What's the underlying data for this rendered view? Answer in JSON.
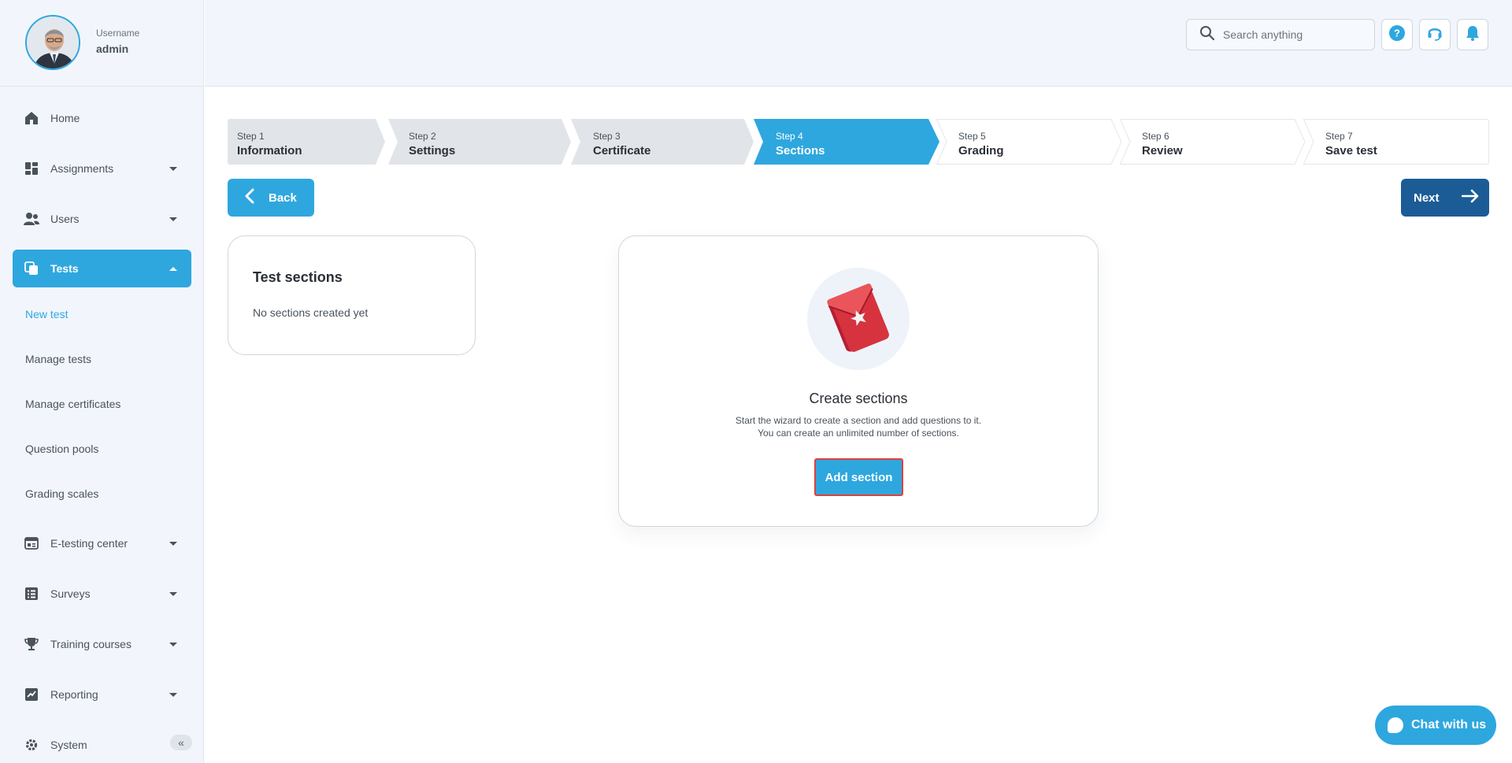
{
  "profile": {
    "label": "Username",
    "name": "admin"
  },
  "sidebar": {
    "items": [
      {
        "label": "Home",
        "icon": "home-icon"
      },
      {
        "label": "Assignments",
        "icon": "assignments-icon"
      },
      {
        "label": "Users",
        "icon": "users-icon"
      },
      {
        "label": "Tests",
        "icon": "tests-icon"
      },
      {
        "label": "E-testing center",
        "icon": "e-testing-icon"
      },
      {
        "label": "Surveys",
        "icon": "surveys-icon"
      },
      {
        "label": "Training courses",
        "icon": "trophy-icon"
      },
      {
        "label": "Reporting",
        "icon": "reporting-icon"
      },
      {
        "label": "System",
        "icon": "gear-icon"
      }
    ],
    "tests_subitems": [
      {
        "label": "New test"
      },
      {
        "label": "Manage tests"
      },
      {
        "label": "Manage certificates"
      },
      {
        "label": "Question pools"
      },
      {
        "label": "Grading scales"
      }
    ],
    "collapse_glyph": "«"
  },
  "header": {
    "search_placeholder": "Search anything"
  },
  "stepper": [
    {
      "num": "Step 1",
      "name": "Information",
      "state": "done"
    },
    {
      "num": "Step 2",
      "name": "Settings",
      "state": "done"
    },
    {
      "num": "Step 3",
      "name": "Certificate",
      "state": "done"
    },
    {
      "num": "Step 4",
      "name": "Sections",
      "state": "active"
    },
    {
      "num": "Step 5",
      "name": "Grading",
      "state": "todo"
    },
    {
      "num": "Step 6",
      "name": "Review",
      "state": "todo"
    },
    {
      "num": "Step 7",
      "name": "Save test",
      "state": "todo"
    }
  ],
  "actions": {
    "back": "Back",
    "next": "Next"
  },
  "sections_card": {
    "title": "Test sections",
    "empty": "No sections created yet"
  },
  "create_card": {
    "title": "Create sections",
    "desc_line1": "Start the wizard to create a section and add questions to it.",
    "desc_line2": "You can create an unlimited number of sections.",
    "button": "Add section"
  },
  "chat": {
    "label": "Chat with us"
  },
  "colors": {
    "accent": "#2ea7df",
    "primary_dark": "#1c5c96",
    "step_done": "#e1e4e8",
    "highlight": "#e0403a"
  }
}
